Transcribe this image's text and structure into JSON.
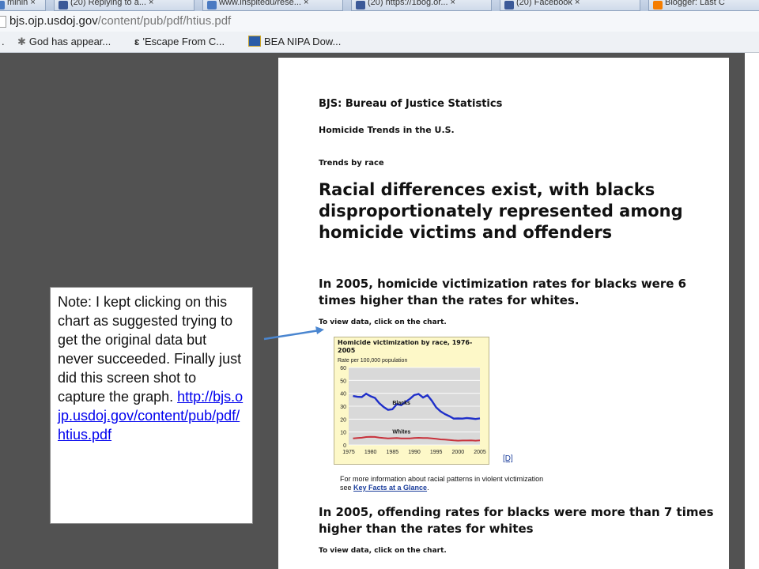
{
  "browser": {
    "tabs": [
      {
        "label": "minin ×",
        "icon": "ie-icon"
      },
      {
        "label": "(20) Replying to a...  ×",
        "icon": "facebook-icon"
      },
      {
        "label": "www.inspitedu/rese...  ×",
        "icon": "ie-icon"
      },
      {
        "label": "(20) https://1bog.or...  ×",
        "icon": "facebook-icon"
      },
      {
        "label": "(20) Facebook  ×",
        "icon": "facebook-icon"
      },
      {
        "label": "Blogger: Last C",
        "icon": "blogger-icon"
      }
    ],
    "url_host": "bjs.ojp.usdoj.gov",
    "url_path": "/content/pub/pdf/htius.pdf",
    "bookmarks": [
      {
        "label": "God has appear...",
        "icon": "star-icon"
      },
      {
        "label": "'Escape From C...",
        "icon": "bookmark-e-icon"
      },
      {
        "label": "BEA NIPA Dow...",
        "icon": "bea-icon"
      }
    ]
  },
  "document": {
    "agency": "BJS: Bureau of Justice Statistics",
    "series_title": "Homicide Trends in the U.S.",
    "section": "Trends by race",
    "headline": "Racial differences exist, with blacks disproportionately represented among homicide victims and offenders",
    "finding_1": "In 2005, homicide victimization rates for blacks were 6 times higher than the rates for whites.",
    "view_data_1": "To view data, click on the chart.",
    "d_link": "[D]",
    "more_info_line1": "For more information about racial patterns in violent victimization",
    "more_info_see": "see ",
    "key_facts": "Key Facts at a Glance",
    "more_info_end": ".",
    "finding_2": "In 2005, offending rates for blacks were more than 7 times higher than the rates for whites",
    "view_data_2": "To view data, click on the chart."
  },
  "chart_data": {
    "type": "line",
    "title": "Homicide victimization by race, 1976-2005",
    "ylabel": "Rate per 100,000 population",
    "x": [
      1976,
      1977,
      1978,
      1979,
      1980,
      1981,
      1982,
      1983,
      1984,
      1985,
      1986,
      1987,
      1988,
      1989,
      1990,
      1991,
      1992,
      1993,
      1994,
      1995,
      1996,
      1997,
      1998,
      1999,
      2000,
      2001,
      2002,
      2003,
      2004,
      2005
    ],
    "series": [
      {
        "name": "Blacks",
        "color": "#1f2fc9",
        "values": [
          37.9,
          37.3,
          37.1,
          39.7,
          37.7,
          36.4,
          32.3,
          29.4,
          27.2,
          27.6,
          31.5,
          30.8,
          33.3,
          35.7,
          38.7,
          39.4,
          36.7,
          38.6,
          34.3,
          29.1,
          26.0,
          23.9,
          22.3,
          20.4,
          20.5,
          20.4,
          20.8,
          20.5,
          20.1,
          20.6
        ]
      },
      {
        "name": "Whites",
        "color": "#c8323c",
        "values": [
          5.1,
          5.4,
          5.6,
          6.1,
          6.3,
          6.2,
          5.7,
          5.3,
          5.1,
          5.2,
          5.4,
          5.1,
          5.0,
          5.1,
          5.4,
          5.5,
          5.3,
          5.3,
          5.0,
          4.8,
          4.3,
          4.1,
          3.8,
          3.5,
          3.3,
          3.4,
          3.4,
          3.5,
          3.3,
          3.5
        ]
      }
    ],
    "yticks": [
      0,
      10,
      20,
      30,
      40,
      50,
      60
    ],
    "xticks": [
      "1975",
      "1980",
      "1985",
      "1990",
      "1995",
      "2000",
      "2005"
    ],
    "ylim": [
      0,
      60
    ],
    "xlim": [
      1975,
      2005
    ]
  },
  "note": {
    "text": "Note: I kept clicking on this chart as suggested trying to get the original data but never succeeded.  Finally just did this screen shot to capture the graph.",
    "link": "http://bjs.ojp.usdoj.gov/content/pub/pdf/htius.pdf"
  },
  "colors": {
    "viewer_background": "#525252",
    "chart_background": "#fdf8c8",
    "arrow": "#4a86d0",
    "link": "#0000ee"
  }
}
